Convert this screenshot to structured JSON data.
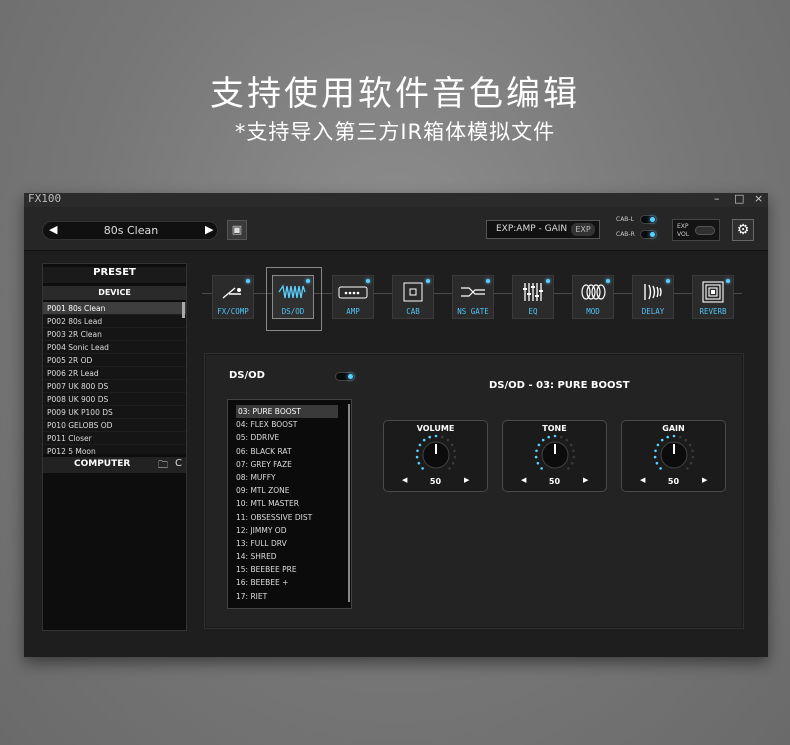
{
  "headline": {
    "line1": "支持使用软件音色编辑",
    "line2": "*支持导入第三方IR箱体模拟文件"
  },
  "window": {
    "title": "FX100",
    "controls": [
      "–",
      "□",
      "×"
    ]
  },
  "topbar": {
    "preset_name": "80s Clean",
    "prev_glyph": "◀",
    "next_glyph": "▶",
    "save_icon": "save-icon",
    "save_glyph": "▣",
    "exp_label": "EXP:AMP - GAIN",
    "exp_tag": "EXP",
    "cab_l": "CAB-L",
    "cab_r": "CAB-R",
    "exp_vol_line1": "EXP",
    "exp_vol_line2": "VOL",
    "gear_glyph": "⚙"
  },
  "sidebar": {
    "preset_header": "PRESET",
    "device_header": "DEVICE",
    "presets": [
      "P001 80s Clean",
      "P002 80s Lead",
      "P003 2R Clean",
      "P004 Sonic Lead",
      "P005 2R OD",
      "P006 2R Lead",
      "P007 UK 800 DS",
      "P008 UK 900 DS",
      "P009 UK P100 DS",
      "P010 GELOBS OD",
      "P011 Closer",
      "P012 5 Moon"
    ],
    "selected_index": 0,
    "computer_header": "COMPUTER",
    "folder_glyph": "🗀",
    "refresh_glyph": "C"
  },
  "fx_chain": [
    {
      "label": "FX/COMP",
      "icon": "compressor-icon"
    },
    {
      "label": "DS/OD",
      "icon": "distortion-icon"
    },
    {
      "label": "AMP",
      "icon": "amplifier-icon"
    },
    {
      "label": "CAB",
      "icon": "cabinet-icon"
    },
    {
      "label": "NS GATE",
      "icon": "noise-gate-icon"
    },
    {
      "label": "EQ",
      "icon": "equalizer-icon"
    },
    {
      "label": "MOD",
      "icon": "modulation-icon"
    },
    {
      "label": "DELAY",
      "icon": "delay-icon"
    },
    {
      "label": "REVERB",
      "icon": "reverb-icon"
    }
  ],
  "active_fx_index": 1,
  "panel": {
    "title": "DS/OD",
    "model_title": "DS/OD - 03: PURE BOOST",
    "models": [
      "03: PURE BOOST",
      "04: FLEX BOOST",
      "05: DDRIVE",
      "06: BLACK RAT",
      "07: GREY FAZE",
      "08: MUFFY",
      "09: MTL ZONE",
      "10: MTL MASTER",
      "11: OBSESSIVE DIST",
      "12: JIMMY OD",
      "13: FULL DRV",
      "14: SHRED",
      "15: BEEBEE PRE",
      "16: BEEBEE +",
      "17: RIET"
    ],
    "selected_model_index": 0,
    "knobs": [
      {
        "label": "VOLUME",
        "value": "50",
        "level": 0.5
      },
      {
        "label": "TONE",
        "value": "50",
        "level": 0.5
      },
      {
        "label": "GAIN",
        "value": "50",
        "level": 0.5
      }
    ],
    "left_arrow": "◀",
    "right_arrow": "▶"
  },
  "colors": {
    "accent": "#4fc3f7",
    "led": "#5ad0ff",
    "background": "#1e1e1e"
  }
}
